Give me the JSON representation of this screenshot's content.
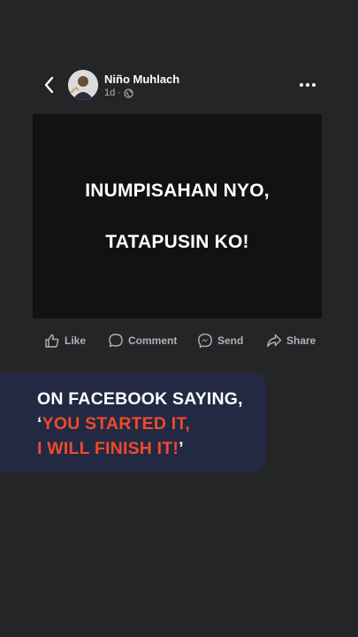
{
  "post": {
    "author": "Niño Muhlach",
    "time": "1d",
    "separator": "·",
    "image_text_line1": "INUMPISAHAN NYO,",
    "image_text_line2": "TATAPUSIN KO!"
  },
  "actions": {
    "like": "Like",
    "comment": "Comment",
    "send": "Send",
    "share": "Share"
  },
  "caption": {
    "line1": "ON FACEBOOK SAYING,",
    "quote_open": "‘",
    "line2": "YOU STARTED IT,",
    "line3": "I WILL FINISH IT!",
    "quote_close": "’"
  },
  "colors": {
    "background": "#242526",
    "banner": "#232943",
    "accent_red": "#ef4a2b"
  },
  "icons": {
    "back": "chevron-left-icon",
    "privacy": "globe-icon",
    "more": "more-dots-icon",
    "like": "thumbs-up-icon",
    "comment": "comment-bubble-icon",
    "send": "messenger-icon",
    "share": "share-arrow-icon"
  }
}
